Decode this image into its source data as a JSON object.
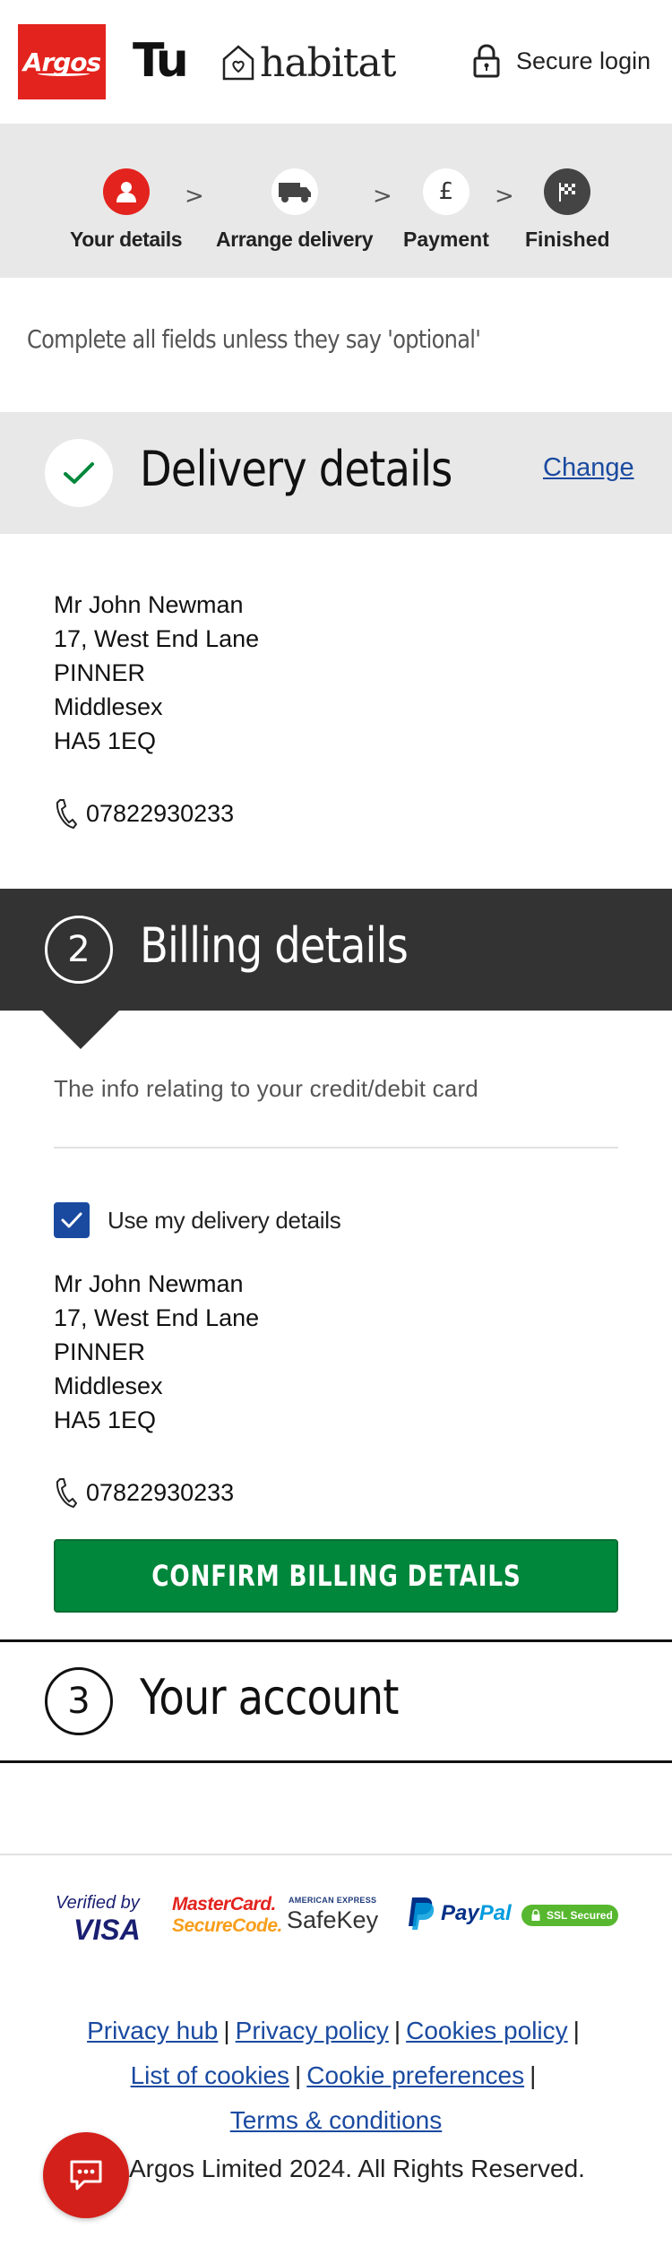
{
  "header": {
    "argos_logo": "Argos",
    "tu_logo": "Tu",
    "habitat_logo": "habitat",
    "secure_login": "Secure login"
  },
  "progress": {
    "steps": [
      {
        "label": "Your details",
        "icon": "person-icon",
        "active": true
      },
      {
        "label": "Arrange delivery",
        "icon": "truck-icon",
        "active": false
      },
      {
        "label": "Payment",
        "icon": "pound-icon",
        "active": false
      },
      {
        "label": "Finished",
        "icon": "flag-icon",
        "active": false
      }
    ],
    "separator": ">"
  },
  "hint": "Complete all fields unless they say 'optional'",
  "delivery": {
    "title": "Delivery details",
    "change_label": "Change",
    "address": [
      "Mr John Newman",
      "17, West End Lane",
      "PINNER",
      "Middlesex",
      "HA5 1EQ"
    ],
    "phone": "07822930233"
  },
  "billing": {
    "step_number": "2",
    "title": "Billing details",
    "info": "The info relating to your credit/debit card",
    "use_delivery_label": "Use my delivery details",
    "use_delivery_checked": true,
    "address": [
      "Mr John Newman",
      "17, West End Lane",
      "PINNER",
      "Middlesex",
      "HA5 1EQ"
    ],
    "phone": "07822930233",
    "confirm_label": "CONFIRM BILLING DETAILS"
  },
  "account": {
    "step_number": "3",
    "title": "Your account"
  },
  "footer": {
    "payment_logos": {
      "verified_by": "Verified by",
      "visa": "VISA",
      "mastercard": "MasterCard.",
      "securecode": "SecureCode.",
      "amex": "AMERICAN EXPRESS",
      "safekey": "SafeKey",
      "paypal_pay": "Pay",
      "paypal_pal": "Pal",
      "ssl": "SSL Secured"
    },
    "links": {
      "privacy_hub": "Privacy hub",
      "privacy_policy": "Privacy policy",
      "cookies_policy": "Cookies policy",
      "list_of_cookies": "List of cookies",
      "cookie_preferences": "Cookie preferences",
      "terms": "Terms & conditions",
      "separator": "|"
    },
    "copyright": "Argos Limited 2024. All Rights Reserved."
  },
  "colors": {
    "brand_red": "#e3231e",
    "link_blue": "#1a4aa0",
    "confirm_green": "#00873c",
    "dark_bar": "#333333",
    "grey_bar": "#e8e8e8"
  }
}
